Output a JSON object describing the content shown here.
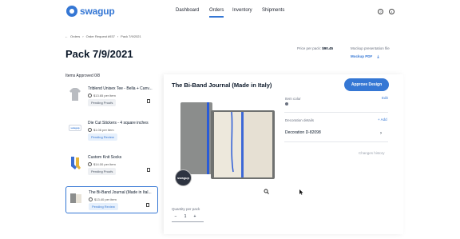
{
  "app": {
    "logo_text": "swagup"
  },
  "nav": {
    "items": [
      "Dashboard",
      "Orders",
      "Inventory",
      "Shipments"
    ],
    "active": "Orders"
  },
  "header_icons": {
    "help": "help-icon",
    "account": "user-icon"
  },
  "breadcrumb": [
    "Orders",
    "Order Request #937",
    "Pack 7/9/2021"
  ],
  "page": {
    "title": "Pack 7/9/2021",
    "price_per_pack_label": "Price per pack:",
    "price_per_pack_value": "$90.45",
    "mockup_label": "Mockup presentation file",
    "mockup_link": "Mockup PDF",
    "items_approved": "Items Approved 0/8"
  },
  "items": [
    {
      "name": "Triblend Unisex Tee - Bella + Canv...",
      "price": "$13.65 per item",
      "status": "Pending Proofs",
      "status_type": "proofs"
    },
    {
      "name": "Die Cut Stickers - 4 square inches",
      "price": "$1.06 per item",
      "status": "Pending Review",
      "status_type": "review"
    },
    {
      "name": "Custom Knit Socks",
      "price": "$14.00 per item",
      "status": "Pending Proofs",
      "status_type": "proofs"
    },
    {
      "name": "The Bi-Band Journal (Made in Ital...",
      "price": "$13.40 per item",
      "status": "Pending Review",
      "status_type": "review"
    }
  ],
  "modal": {
    "title": "The Bi-Band Journal (Made in Italy)",
    "approve_button": "Approve Design",
    "item_color_label": "Item color",
    "edit_label": "Edit",
    "decoration_label": "Decoration details",
    "add_label": "+ Add",
    "decoration_item": "Decoration D-82098",
    "changes_history": "Changes history",
    "quantity_label": "Quantity per pack",
    "quantity_minus": "−",
    "quantity_value": "1",
    "quantity_plus": "+",
    "thumb_text": "swagup"
  },
  "colors": {
    "accent": "#3577d4",
    "text_dark": "#0b1829",
    "journal_cover": "#8b8d8c",
    "journal_band": "#2a5bd7"
  }
}
